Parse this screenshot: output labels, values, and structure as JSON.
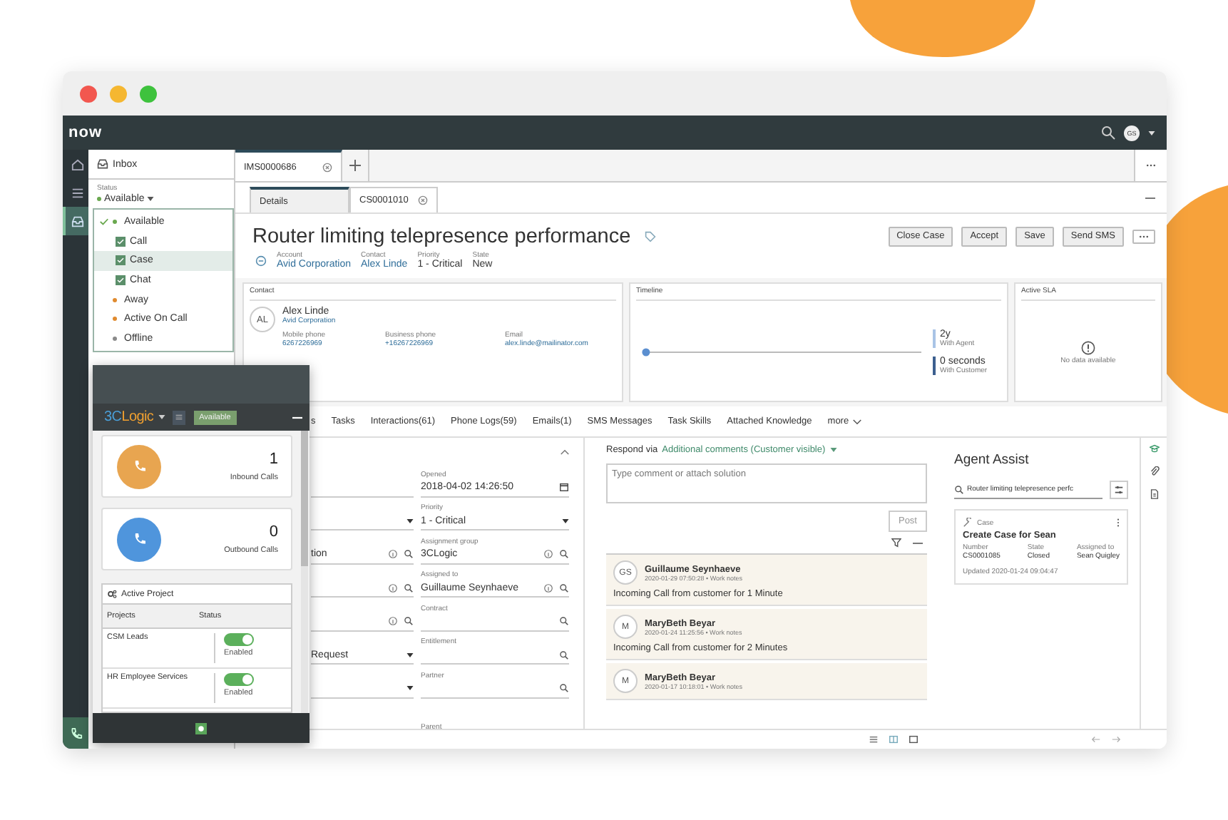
{
  "window_buttons": [
    {
      "color": "#f2574f"
    },
    {
      "color": "#f5b731"
    },
    {
      "color": "#3ec23d"
    }
  ],
  "app_header": {
    "logo": "now",
    "avatar": "GS"
  },
  "nav_rail": [
    {
      "kind": "home",
      "selected": false
    },
    {
      "kind": "list",
      "selected": false
    },
    {
      "kind": "inbox",
      "selected": true
    }
  ],
  "inbox_panel": {
    "title": "Inbox",
    "status": {
      "label": "Status",
      "value": "Available",
      "color": "#6aa84f"
    },
    "options": [
      {
        "kind": "status",
        "label": "Available",
        "color": "#6aa84f",
        "checked": true,
        "selected": false
      },
      {
        "kind": "channel",
        "label": "Call",
        "checked": true,
        "selected": false
      },
      {
        "kind": "channel",
        "label": "Case",
        "checked": true,
        "selected": true
      },
      {
        "kind": "channel",
        "label": "Chat",
        "checked": true,
        "selected": false
      },
      {
        "kind": "status",
        "label": "Away",
        "color": "#e08a2e",
        "checked": false,
        "selected": false
      },
      {
        "kind": "status",
        "label": "Active On Call",
        "color": "#e08a2e",
        "checked": false,
        "selected": false
      },
      {
        "kind": "status",
        "label": "Offline",
        "color": "#8a8a8a",
        "checked": false,
        "selected": false
      }
    ]
  },
  "record_tabs": [
    {
      "label": "IMS0000686",
      "selected": true,
      "closable": true
    }
  ],
  "subtabs": [
    {
      "label": "Details",
      "selected": true,
      "closable": false
    },
    {
      "label": "CS0001010",
      "selected": false,
      "closable": true
    }
  ],
  "record": {
    "title": "Router limiting telepresence performance",
    "actions": [
      "Close Case",
      "Accept",
      "Save",
      "Send SMS"
    ],
    "fields": [
      {
        "label": "Account",
        "value": "Avid Corporation",
        "link": true
      },
      {
        "label": "Contact",
        "value": "Alex Linde",
        "link": true
      },
      {
        "label": "Priority",
        "value": "1 - Critical",
        "link": false
      },
      {
        "label": "State",
        "value": "New",
        "link": false
      }
    ]
  },
  "contact_card": {
    "title": "Contact",
    "initials": "AL",
    "name": "Alex Linde",
    "company": "Avid Corporation",
    "details": [
      {
        "label": "Mobile phone",
        "value": "6267226969"
      },
      {
        "label": "Business phone",
        "value": "+16267226969"
      },
      {
        "label": "Email",
        "value": "alex.linde@mailinator.com"
      }
    ]
  },
  "timeline_card": {
    "title": "Timeline",
    "segments": [
      {
        "value": "2y",
        "label": "With Agent",
        "color": "#a9c4e6"
      },
      {
        "value": "0 seconds",
        "label": "With Customer",
        "color": "#3c5f8f"
      }
    ]
  },
  "sla_card": {
    "title": "Active SLA",
    "message": "No data available"
  },
  "related_tabs": [
    "s",
    "Tasks",
    "Interactions(61)",
    "Phone Logs(59)",
    "Emails(1)",
    "SMS Messages",
    "Task Skills",
    "Attached Knowledge"
  ],
  "related_more": "more",
  "form": {
    "left_fields": [
      {
        "kind": "text"
      },
      {
        "kind": "select"
      },
      {
        "kind": "reference",
        "value": "tion"
      },
      {
        "kind": "reference"
      },
      {
        "kind": "reference"
      },
      {
        "kind": "select",
        "value": "Request"
      },
      {
        "kind": "select"
      }
    ],
    "right_fields": [
      {
        "label": "Opened",
        "value": "2018-04-02 14:26:50",
        "kind": "date"
      },
      {
        "label": "Priority",
        "value": "1 - Critical",
        "kind": "select"
      },
      {
        "label": "Assignment group",
        "value": "3CLogic",
        "kind": "reference"
      },
      {
        "label": "Assigned to",
        "value": "Guillaume Seynhaeve",
        "kind": "reference"
      },
      {
        "label": "Contract",
        "kind": "lookup"
      },
      {
        "label": "Entitlement",
        "kind": "lookup"
      },
      {
        "label": "Partner",
        "kind": "lookup"
      },
      {
        "label": "Parent",
        "kind": "cut"
      }
    ]
  },
  "activity": {
    "respond_label": "Respond via",
    "respond_channel": "Additional comments (Customer visible)",
    "placeholder": "Type comment or attach solution",
    "post": "Post",
    "entries": [
      {
        "initials": "GS",
        "author": "Guillaume Seynhaeve",
        "meta": "2020-01-29 07:50:28 • Work notes",
        "text": "Incoming Call from customer for 1 Minute"
      },
      {
        "initials": "M",
        "author": "MaryBeth Beyar",
        "meta": "2020-01-24 11:25:56 • Work notes",
        "text": "Incoming Call from customer for 2 Minutes"
      },
      {
        "initials": "M",
        "author": "MaryBeth Beyar",
        "meta": "2020-01-17 10:18:01 • Work notes"
      }
    ]
  },
  "agent_assist": {
    "title": "Agent Assist",
    "search_value": "Router limiting telepresence perfc",
    "result": {
      "type": "Case",
      "title": "Create Case for Sean",
      "fields": [
        {
          "label": "Number",
          "value": "CS0001085"
        },
        {
          "label": "State",
          "value": "Closed"
        },
        {
          "label": "Assigned to",
          "value": "Sean Quigley"
        }
      ],
      "updated": "Updated 2020-01-24 09:04:47"
    }
  },
  "softphone": {
    "logo": [
      {
        "text": "3C",
        "color": "#4a9fd8"
      },
      {
        "text": "Logic",
        "color": "#f0a030"
      }
    ],
    "status": "Available",
    "counters": [
      {
        "count": "1",
        "label": "Inbound Calls",
        "color": "#e8a550"
      },
      {
        "count": "0",
        "label": "Outbound Calls",
        "color": "#4f95dc"
      }
    ],
    "project_title": "Active Project",
    "columns": [
      "Projects",
      "Status"
    ],
    "projects": [
      {
        "name": "CSM Leads",
        "on": true,
        "state": "Enabled"
      },
      {
        "name": "HR Employee Services",
        "on": true,
        "state": "Enabled"
      }
    ]
  }
}
